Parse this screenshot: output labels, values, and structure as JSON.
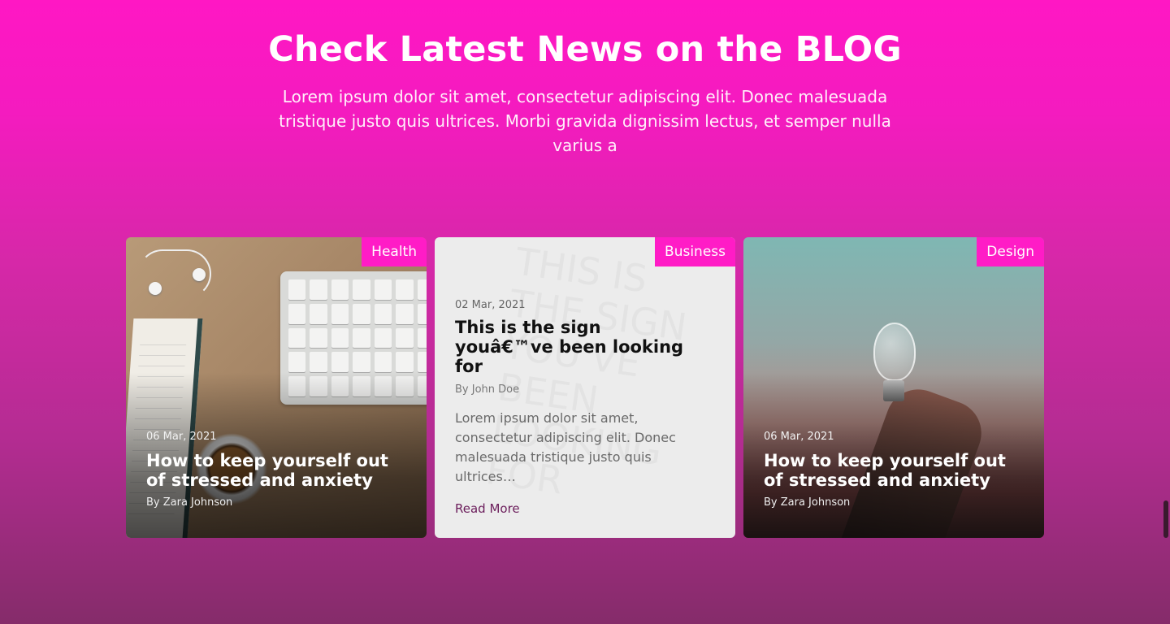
{
  "header": {
    "title": "Check Latest News on the BLOG",
    "subtitle": "Lorem ipsum dolor sit amet, consectetur adipiscing elit. Donec malesuada tristique justo quis ultrices. Morbi gravida dignissim lectus, et semper nulla varius a"
  },
  "cards": [
    {
      "tag": "Health",
      "date": "06 Mar, 2021",
      "title": "How to keep yourself out of stressed and anxiety",
      "author": "By Zara Johnson"
    },
    {
      "tag": "Business",
      "date": "02 Mar, 2021",
      "title": "This is the sign youâ€™ve been looking for",
      "author": "By John Doe",
      "excerpt": "Lorem ipsum dolor sit amet, consectetur adipiscing elit. Donec malesuada tristique justo quis ultrices…",
      "read_more": "Read More"
    },
    {
      "tag": "Design",
      "date": "06 Mar, 2021",
      "title": "How to keep yourself out of stressed and anxiety",
      "author": "By Zara Johnson"
    }
  ],
  "colors": {
    "accent": "#ff1cc6",
    "background_top": "#ff17c4",
    "background_bottom": "#852c6a",
    "read_more": "#6b1d5b"
  }
}
